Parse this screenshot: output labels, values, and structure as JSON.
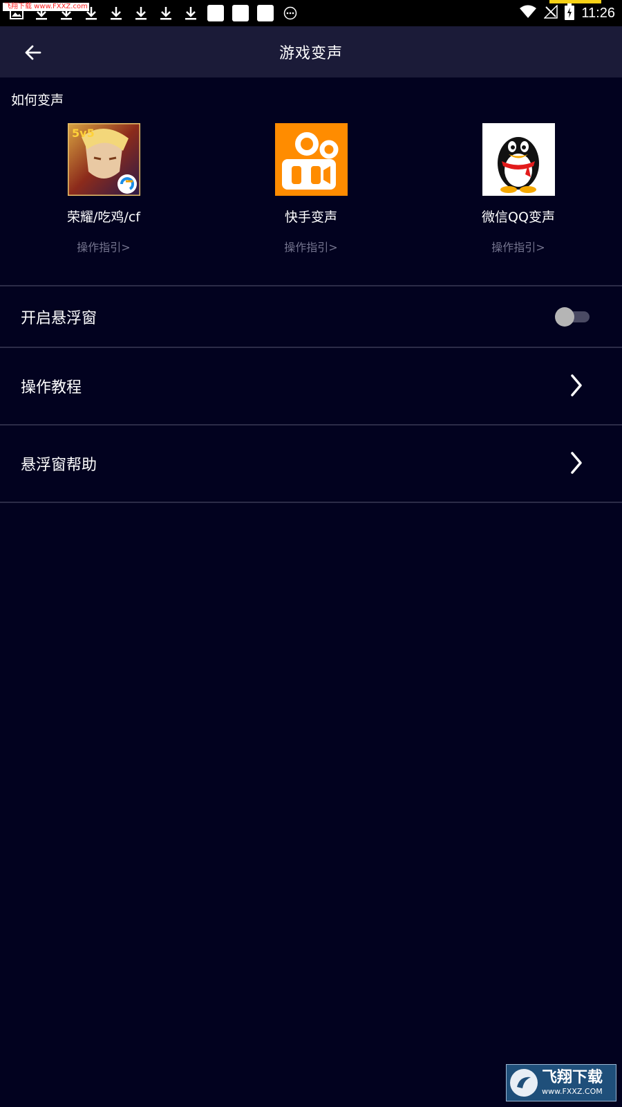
{
  "status_bar": {
    "watermark": "飞翔下载 www.FXXZ.com",
    "time": "11:26",
    "icons": [
      "image-icon",
      "download-icon",
      "download-icon",
      "download-icon",
      "download-icon",
      "download-icon",
      "download-icon",
      "download-icon",
      "app-square",
      "app-square",
      "app-square",
      "more-icon",
      "wifi-icon",
      "no-signal-icon",
      "battery-charging-icon"
    ]
  },
  "header": {
    "title": "游戏变声",
    "back_icon": "arrow-left-icon"
  },
  "how_section": {
    "title": "如何变声",
    "apps": [
      {
        "name": "荣耀/吃鸡/cf",
        "guide": "操作指引>",
        "icon": "honor-of-kings-icon"
      },
      {
        "name": "快手变声",
        "guide": "操作指引>",
        "icon": "kuaishou-icon"
      },
      {
        "name": "微信QQ变声",
        "guide": "操作指引>",
        "icon": "qq-penguin-icon"
      }
    ]
  },
  "settings": {
    "floating_window": {
      "label": "开启悬浮窗",
      "enabled": false
    },
    "tutorial": {
      "label": "操作教程"
    },
    "floating_help": {
      "label": "悬浮窗帮助"
    }
  },
  "watermark_logo": {
    "cn": "飞翔下载",
    "url": "www.FXXZ.COM"
  },
  "colors": {
    "background": "#02021f",
    "header": "#1b1b38",
    "divider": "#2c2c48",
    "muted_text": "#75758f",
    "kuaishou_orange": "#ff8c00"
  }
}
